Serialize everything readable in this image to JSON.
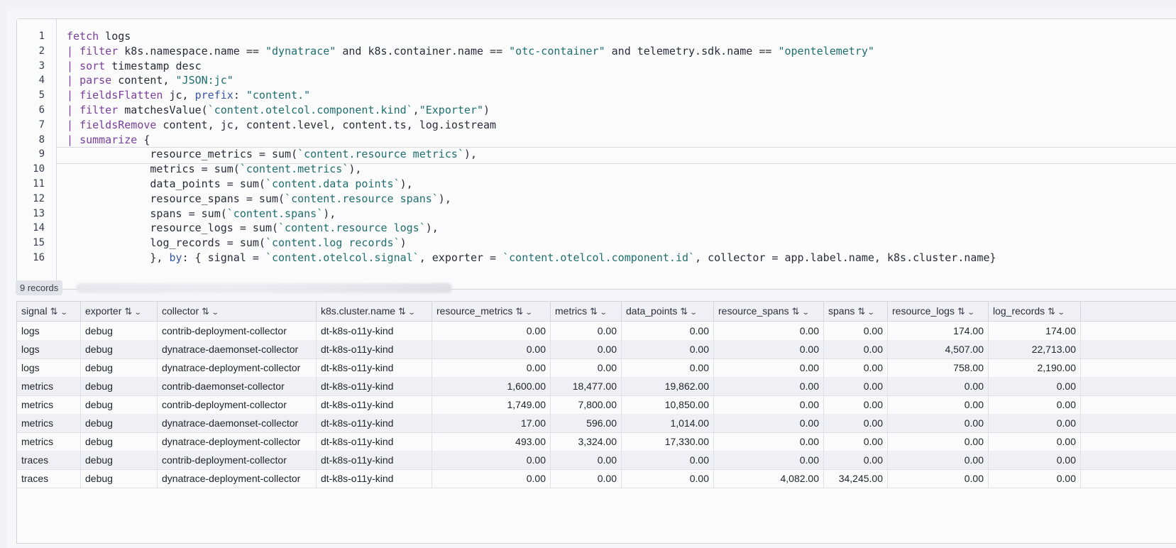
{
  "editor": {
    "lines": [
      {
        "n": "1",
        "tokens": [
          {
            "t": "fetch",
            "c": "kw"
          },
          {
            "t": " logs",
            "c": "cmt"
          }
        ]
      },
      {
        "n": "2",
        "tokens": [
          {
            "t": "| ",
            "c": "kw"
          },
          {
            "t": "filter",
            "c": "kw"
          },
          {
            "t": " k8s.namespace.name == ",
            "c": "cmt"
          },
          {
            "t": "\"dynatrace\"",
            "c": "str"
          },
          {
            "t": " and k8s.container.name == ",
            "c": "cmt"
          },
          {
            "t": "\"otc-container\"",
            "c": "str"
          },
          {
            "t": " and telemetry.sdk.name == ",
            "c": "cmt"
          },
          {
            "t": "\"opentelemetry\"",
            "c": "str"
          }
        ]
      },
      {
        "n": "3",
        "tokens": [
          {
            "t": "| ",
            "c": "kw"
          },
          {
            "t": "sort",
            "c": "kw"
          },
          {
            "t": " timestamp desc",
            "c": "cmt"
          }
        ]
      },
      {
        "n": "4",
        "tokens": [
          {
            "t": "| ",
            "c": "kw"
          },
          {
            "t": "parse",
            "c": "kw"
          },
          {
            "t": " content, ",
            "c": "cmt"
          },
          {
            "t": "\"JSON:jc\"",
            "c": "str"
          }
        ]
      },
      {
        "n": "5",
        "tokens": [
          {
            "t": "| ",
            "c": "kw"
          },
          {
            "t": "fieldsFlatten",
            "c": "kw"
          },
          {
            "t": " jc, ",
            "c": "cmt"
          },
          {
            "t": "prefix",
            "c": "prm"
          },
          {
            "t": ": ",
            "c": "cmt"
          },
          {
            "t": "\"content.\"",
            "c": "str"
          }
        ]
      },
      {
        "n": "6",
        "tokens": [
          {
            "t": "| ",
            "c": "kw"
          },
          {
            "t": "filter",
            "c": "kw"
          },
          {
            "t": " matchesValue(",
            "c": "cmt"
          },
          {
            "t": "`content.otelcol.component.kind`",
            "c": "str"
          },
          {
            "t": ",",
            "c": "cmt"
          },
          {
            "t": "\"Exporter\"",
            "c": "str"
          },
          {
            "t": ")",
            "c": "cmt"
          }
        ]
      },
      {
        "n": "7",
        "tokens": [
          {
            "t": "| ",
            "c": "kw"
          },
          {
            "t": "fieldsRemove",
            "c": "kw"
          },
          {
            "t": " content, jc, content.level, content.ts, log.iostream",
            "c": "cmt"
          }
        ]
      },
      {
        "n": "8",
        "tokens": [
          {
            "t": "| ",
            "c": "kw"
          },
          {
            "t": "summarize",
            "c": "kw"
          },
          {
            "t": " {",
            "c": "cmt"
          }
        ]
      },
      {
        "n": "9",
        "tokens": [
          {
            "t": "             resource_metrics = sum(",
            "c": "cmt"
          },
          {
            "t": "`content.resource metrics`",
            "c": "str"
          },
          {
            "t": "),",
            "c": "cmt"
          }
        ]
      },
      {
        "n": "10",
        "tokens": [
          {
            "t": "             metrics = sum(",
            "c": "cmt"
          },
          {
            "t": "`content.metrics`",
            "c": "str"
          },
          {
            "t": "),",
            "c": "cmt"
          }
        ]
      },
      {
        "n": "11",
        "tokens": [
          {
            "t": "             data_points = sum(",
            "c": "cmt"
          },
          {
            "t": "`content.data points`",
            "c": "str"
          },
          {
            "t": "),",
            "c": "cmt"
          }
        ]
      },
      {
        "n": "12",
        "tokens": [
          {
            "t": "             resource_spans = sum(",
            "c": "cmt"
          },
          {
            "t": "`content.resource spans`",
            "c": "str"
          },
          {
            "t": "),",
            "c": "cmt"
          }
        ]
      },
      {
        "n": "13",
        "tokens": [
          {
            "t": "             spans = sum(",
            "c": "cmt"
          },
          {
            "t": "`content.spans`",
            "c": "str"
          },
          {
            "t": "),",
            "c": "cmt"
          }
        ]
      },
      {
        "n": "14",
        "tokens": [
          {
            "t": "             resource_logs = sum(",
            "c": "cmt"
          },
          {
            "t": "`content.resource logs`",
            "c": "str"
          },
          {
            "t": "),",
            "c": "cmt"
          }
        ]
      },
      {
        "n": "15",
        "tokens": [
          {
            "t": "             log_records = sum(",
            "c": "cmt"
          },
          {
            "t": "`content.log records`",
            "c": "str"
          },
          {
            "t": ")",
            "c": "cmt"
          }
        ]
      },
      {
        "n": "16",
        "tokens": [
          {
            "t": "             }, ",
            "c": "cmt"
          },
          {
            "t": "by",
            "c": "prm"
          },
          {
            "t": ": { signal = ",
            "c": "cmt"
          },
          {
            "t": "`content.otelcol.signal`",
            "c": "str"
          },
          {
            "t": ", exporter = ",
            "c": "cmt"
          },
          {
            "t": "`content.otelcol.component.id`",
            "c": "str"
          },
          {
            "t": ", collector = app.label.name, k8s.cluster.name}",
            "c": "cmt"
          }
        ]
      }
    ]
  },
  "results": {
    "records_label": "9 records"
  },
  "table": {
    "columns": [
      {
        "label": "signal"
      },
      {
        "label": "exporter"
      },
      {
        "label": "collector"
      },
      {
        "label": "k8s.cluster.name"
      },
      {
        "label": "resource_metrics"
      },
      {
        "label": "metrics"
      },
      {
        "label": "data_points"
      },
      {
        "label": "resource_spans"
      },
      {
        "label": "spans"
      },
      {
        "label": "resource_logs"
      },
      {
        "label": "log_records"
      }
    ],
    "sort_icon": "⇅",
    "chevron_icon": "⌄",
    "rows": [
      [
        "logs",
        "debug",
        "contrib-deployment-collector",
        "dt-k8s-o11y-kind",
        "0.00",
        "0.00",
        "0.00",
        "0.00",
        "0.00",
        "174.00",
        "174.00"
      ],
      [
        "logs",
        "debug",
        "dynatrace-daemonset-collector",
        "dt-k8s-o11y-kind",
        "0.00",
        "0.00",
        "0.00",
        "0.00",
        "0.00",
        "4,507.00",
        "22,713.00"
      ],
      [
        "logs",
        "debug",
        "dynatrace-deployment-collector",
        "dt-k8s-o11y-kind",
        "0.00",
        "0.00",
        "0.00",
        "0.00",
        "0.00",
        "758.00",
        "2,190.00"
      ],
      [
        "metrics",
        "debug",
        "contrib-daemonset-collector",
        "dt-k8s-o11y-kind",
        "1,600.00",
        "18,477.00",
        "19,862.00",
        "0.00",
        "0.00",
        "0.00",
        "0.00"
      ],
      [
        "metrics",
        "debug",
        "contrib-deployment-collector",
        "dt-k8s-o11y-kind",
        "1,749.00",
        "7,800.00",
        "10,850.00",
        "0.00",
        "0.00",
        "0.00",
        "0.00"
      ],
      [
        "metrics",
        "debug",
        "dynatrace-daemonset-collector",
        "dt-k8s-o11y-kind",
        "17.00",
        "596.00",
        "1,014.00",
        "0.00",
        "0.00",
        "0.00",
        "0.00"
      ],
      [
        "metrics",
        "debug",
        "dynatrace-deployment-collector",
        "dt-k8s-o11y-kind",
        "493.00",
        "3,324.00",
        "17,330.00",
        "0.00",
        "0.00",
        "0.00",
        "0.00"
      ],
      [
        "traces",
        "debug",
        "contrib-deployment-collector",
        "dt-k8s-o11y-kind",
        "0.00",
        "0.00",
        "0.00",
        "0.00",
        "0.00",
        "0.00",
        "0.00"
      ],
      [
        "traces",
        "debug",
        "dynatrace-deployment-collector",
        "dt-k8s-o11y-kind",
        "0.00",
        "0.00",
        "0.00",
        "4,082.00",
        "34,245.00",
        "0.00",
        "0.00"
      ]
    ]
  }
}
